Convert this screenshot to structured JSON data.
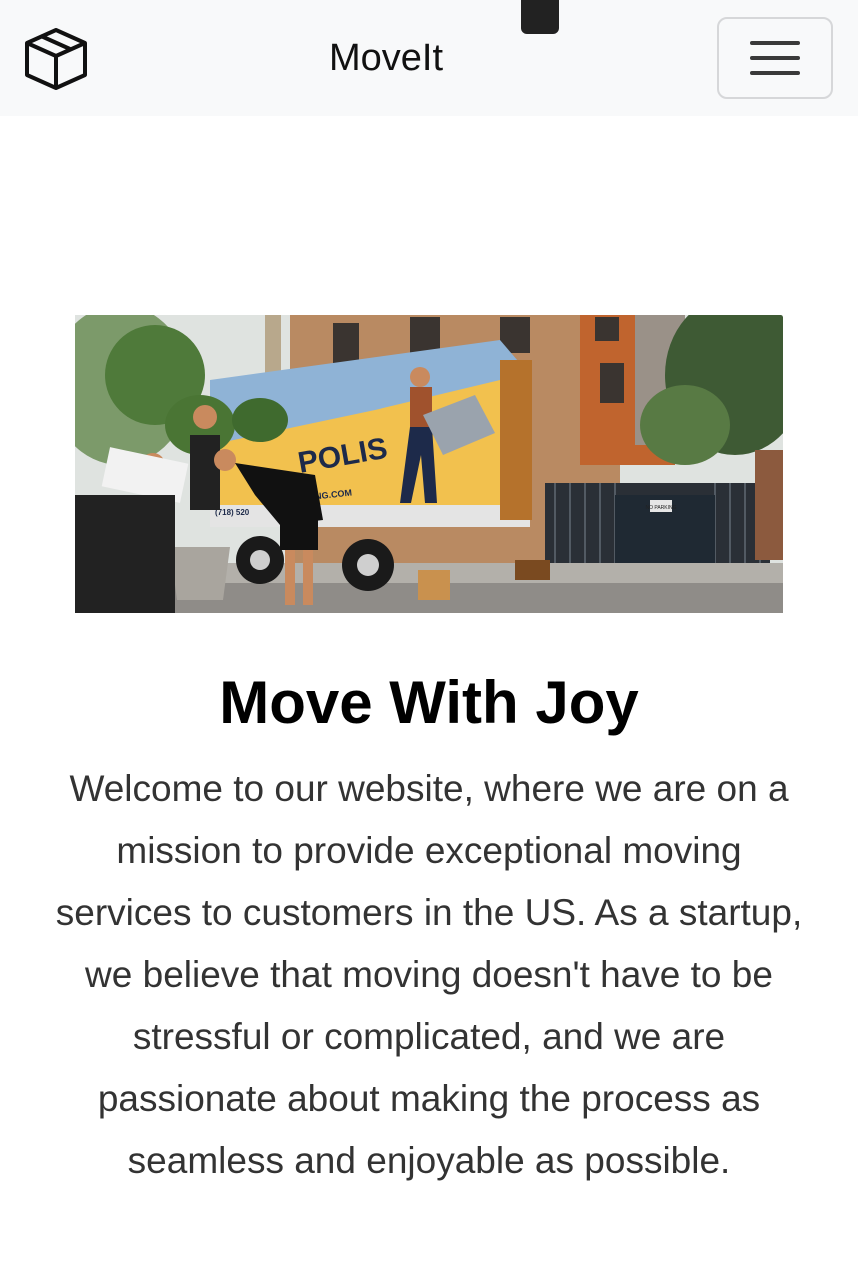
{
  "navbar": {
    "brand_icon": "box-icon",
    "title": "MoveIt",
    "toggler_icon": "hamburger-menu-icon"
  },
  "hero": {
    "image": "moving-truck-photo",
    "truck_text_1": "POLIS",
    "truck_text_2": "OVING.COM",
    "truck_text_3": "(718)  520",
    "sign_text": "NO PARKING",
    "headline": "Move With Joy",
    "lead": "Welcome to our website, where we are on a mission to provide exceptional moving services to customers in the US. As a startup, we believe that moving doesn't have to be stressful or complicated, and we are passionate about making the process as seamless and enjoyable as possible."
  },
  "colors": {
    "navbar_bg": "#f8f9fa",
    "truck_blue": "#8fb3d6",
    "truck_yellow": "#f2c14e"
  }
}
